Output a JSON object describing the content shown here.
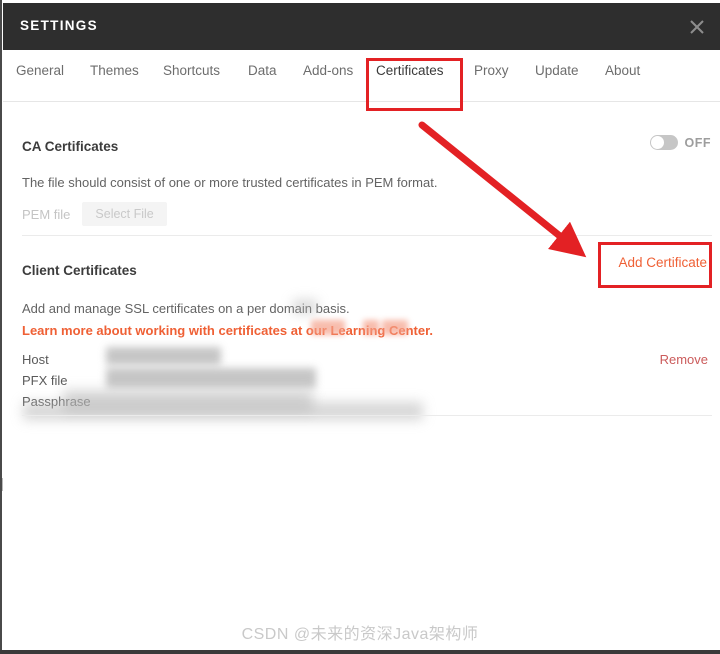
{
  "window": {
    "title": "SETTINGS",
    "close_icon": "close-icon"
  },
  "tabs": [
    {
      "label": "General",
      "active": false
    },
    {
      "label": "Themes",
      "active": false
    },
    {
      "label": "Shortcuts",
      "active": false
    },
    {
      "label": "Data",
      "active": false
    },
    {
      "label": "Add-ons",
      "active": false
    },
    {
      "label": "Certificates",
      "active": true
    },
    {
      "label": "Proxy",
      "active": false
    },
    {
      "label": "Update",
      "active": false
    },
    {
      "label": "About",
      "active": false
    }
  ],
  "ca_section": {
    "title": "CA Certificates",
    "toggle_state": "OFF",
    "description": "The file should consist of one or more trusted certificates in PEM format.",
    "pem_label": "PEM file",
    "select_file_label": "Select File"
  },
  "client_section": {
    "title": "Client Certificates",
    "add_button_label": "Add Certificate",
    "description": "Add and manage SSL certificates on a per domain basis.",
    "link_text": "Learn more about working with certificates at our Learning Center.",
    "link_visible_prefix": "Learn more about working with certificates at ou",
    "link_visible_suffix": ".",
    "rows": [
      {
        "label": "Host",
        "value": ""
      },
      {
        "label": "PFX file",
        "value": ""
      },
      {
        "label": "Passphrase",
        "value": ""
      }
    ],
    "remove_label": "Remove"
  },
  "annotations": {
    "certificates_tab_box": true,
    "add_certificate_box": true,
    "arrow": true
  },
  "colors": {
    "accent_orange": "#ef6035",
    "title_bar": "#2e2e2e",
    "annotation_red": "#e32124",
    "remove_red": "#cb5b5b"
  },
  "watermark": {
    "text": "CSDN @未来的资深Java架构师"
  }
}
